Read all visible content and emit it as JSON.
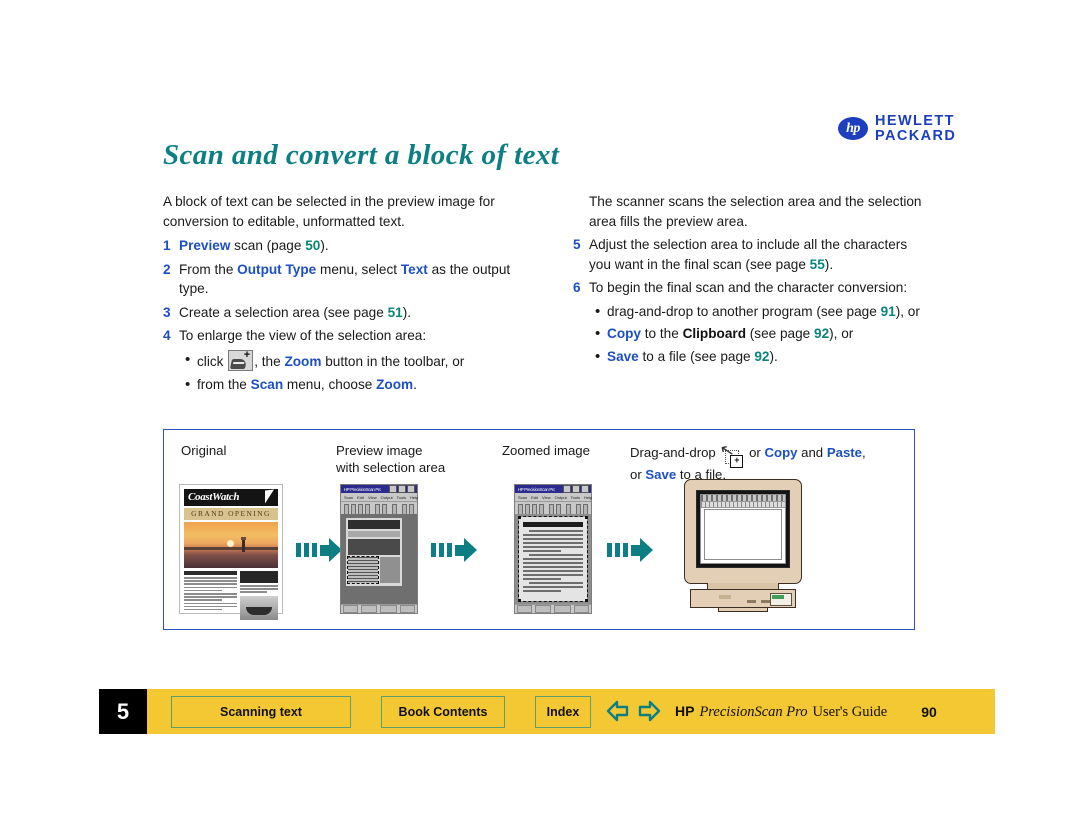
{
  "brand": {
    "logo_letters": "hp",
    "line1": "HEWLETT",
    "line2": "PACKARD",
    "logo_color": "#1d3fbe"
  },
  "colors": {
    "title_teal": "#0c7f82",
    "link_blue": "#1d4fc4",
    "page_ref_green": "#0a8577",
    "footer_yellow": "#f3c832",
    "footer_button_border": "#5aa06a",
    "panel_border": "#2d4fc0",
    "arrow_teal": "#0d7f84"
  },
  "title": "Scan and convert a block of text",
  "left_column": {
    "intro": "A block of text can be selected in the preview image for conversion to editable, unformatted text.",
    "steps": [
      {
        "num": "1",
        "parts": [
          {
            "t": "Preview",
            "s": "b"
          },
          {
            "t": " scan (page ",
            "s": "n"
          },
          {
            "t": "50",
            "s": "pg"
          },
          {
            "t": ").",
            "s": "n"
          }
        ]
      },
      {
        "num": "2",
        "parts": [
          {
            "t": "From the ",
            "s": "n"
          },
          {
            "t": "Output Type",
            "s": "b"
          },
          {
            "t": " menu, select ",
            "s": "n"
          },
          {
            "t": "Text",
            "s": "b"
          },
          {
            "t": " as the output type.",
            "s": "n"
          }
        ]
      },
      {
        "num": "3",
        "parts": [
          {
            "t": "Create a selection area (see page ",
            "s": "n"
          },
          {
            "t": "51",
            "s": "pg"
          },
          {
            "t": ").",
            "s": "n"
          }
        ]
      },
      {
        "num": "4",
        "parts": [
          {
            "t": "To enlarge the view of the selection area:",
            "s": "n"
          }
        ]
      }
    ],
    "bullets": [
      {
        "icon": "zoom-toolbar-icon",
        "parts": [
          {
            "t": "click ",
            "s": "n"
          },
          {
            "t": "__ICON__",
            "s": "icon"
          },
          {
            "t": ", the ",
            "s": "n"
          },
          {
            "t": "Zoom",
            "s": "b"
          },
          {
            "t": " button in the toolbar, or",
            "s": "n"
          }
        ]
      },
      {
        "parts": [
          {
            "t": "from the ",
            "s": "n"
          },
          {
            "t": "Scan",
            "s": "b"
          },
          {
            "t": " menu, choose ",
            "s": "n"
          },
          {
            "t": "Zoom",
            "s": "b"
          },
          {
            "t": ".",
            "s": "n"
          }
        ]
      }
    ]
  },
  "right_column": {
    "intro": "The scanner scans the selection area and the selection area fills the preview area.",
    "steps": [
      {
        "num": "5",
        "parts": [
          {
            "t": "Adjust the selection area to include all the characters you want in the final scan (see page ",
            "s": "n"
          },
          {
            "t": "55",
            "s": "pg"
          },
          {
            "t": ").",
            "s": "n"
          }
        ]
      },
      {
        "num": "6",
        "parts": [
          {
            "t": "To begin the final scan and the character conversion:",
            "s": "n"
          }
        ]
      }
    ],
    "bullets": [
      {
        "parts": [
          {
            "t": "drag-and-drop to another program (see page ",
            "s": "n"
          },
          {
            "t": "91",
            "s": "pg"
          },
          {
            "t": "), or",
            "s": "n"
          }
        ]
      },
      {
        "parts": [
          {
            "t": "Copy",
            "s": "b"
          },
          {
            "t": " to the ",
            "s": "n"
          },
          {
            "t": "Clipboard",
            "s": "bk"
          },
          {
            "t": " (see page ",
            "s": "n"
          },
          {
            "t": "92",
            "s": "pg"
          },
          {
            "t": "), or",
            "s": "n"
          }
        ]
      },
      {
        "parts": [
          {
            "t": "Save",
            "s": "b"
          },
          {
            "t": " to a file (see page ",
            "s": "n"
          },
          {
            "t": "92",
            "s": "pg"
          },
          {
            "t": ").",
            "s": "n"
          }
        ]
      }
    ]
  },
  "illustration": {
    "labels": {
      "original": "Original",
      "preview_line1": "Preview image",
      "preview_line2": "with selection area",
      "zoomed": "Zoomed image",
      "dragdrop_parts": [
        {
          "t": "Drag-and-drop ",
          "s": "n"
        },
        {
          "t": "__CURSOR__",
          "s": "icon"
        },
        {
          "t": " or ",
          "s": "n"
        },
        {
          "t": "Copy",
          "s": "b"
        },
        {
          "t": " and ",
          "s": "n"
        },
        {
          "t": "Paste",
          "s": "b"
        },
        {
          "t": ",",
          "s": "n"
        },
        {
          "t": "__BR__",
          "s": "br"
        },
        {
          "t": "or ",
          "s": "n"
        },
        {
          "t": "Save",
          "s": "b"
        },
        {
          "t": " to a file.",
          "s": "n"
        }
      ]
    },
    "newsletter": {
      "masthead": "CoastWatch",
      "banner": "GRAND OPENING"
    }
  },
  "footer": {
    "chapter": "5",
    "buttons": [
      {
        "label": "Scanning text",
        "name": "scanning-text"
      },
      {
        "label": "Book Contents",
        "name": "book-contents"
      },
      {
        "label": "Index",
        "name": "index"
      }
    ],
    "nav_prev_icon": "arrow-left-icon",
    "nav_next_icon": "arrow-right-icon",
    "guide_hp": "HP",
    "guide_product": "PrecisionScan Pro",
    "guide_suffix": "User's Guide",
    "page_number": "90"
  }
}
